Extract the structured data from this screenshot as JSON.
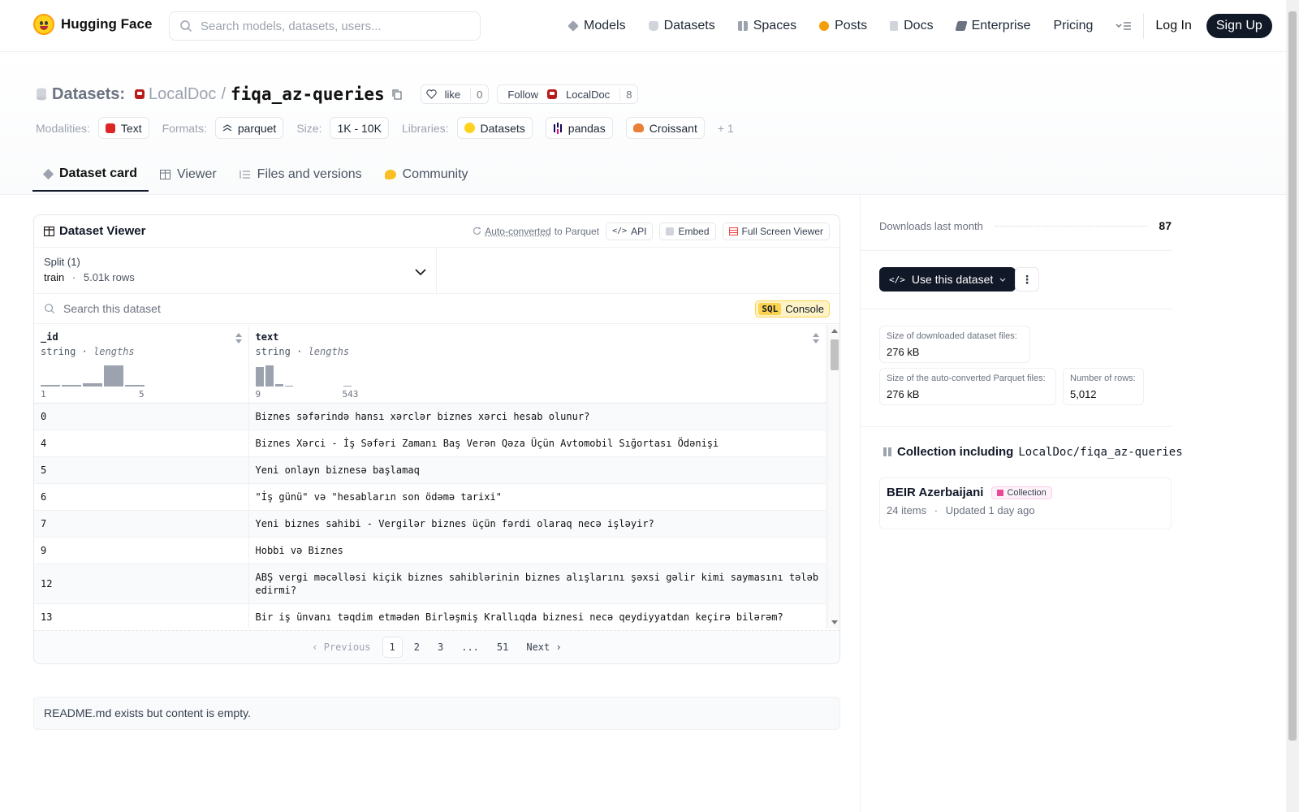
{
  "header": {
    "brand": "Hugging Face",
    "search_placeholder": "Search models, datasets, users...",
    "nav": [
      {
        "label": "Models",
        "icon": "models-icon",
        "color": "#6b7280"
      },
      {
        "label": "Datasets",
        "icon": "datasets-icon",
        "color": "#9ca3af"
      },
      {
        "label": "Spaces",
        "icon": "spaces-icon",
        "color": "#9ca3af"
      },
      {
        "label": "Posts",
        "icon": "posts-icon",
        "color": "#f59e0b"
      },
      {
        "label": "Docs",
        "icon": "docs-icon",
        "color": "#9ca3af"
      },
      {
        "label": "Enterprise",
        "icon": "enterprise-icon",
        "color": "#6b7280"
      },
      {
        "label": "Pricing",
        "icon": "",
        "color": ""
      }
    ],
    "login": "Log In",
    "signup": "Sign Up"
  },
  "repo": {
    "type_label": "Datasets:",
    "org": "LocalDoc",
    "slash": "/",
    "name": "fiqa_az-queries",
    "like_label": "like",
    "like_count": "0",
    "follow_label": "Follow",
    "follow_org": "LocalDoc",
    "follow_count": "8"
  },
  "meta": {
    "modalities_label": "Modalities:",
    "modality": "Text",
    "formats_label": "Formats:",
    "format": "parquet",
    "size_label": "Size:",
    "size": "1K - 10K",
    "libraries_label": "Libraries:",
    "libraries": [
      "Datasets",
      "pandas",
      "Croissant"
    ],
    "more": "+ 1"
  },
  "tabs": [
    "Dataset card",
    "Viewer",
    "Files and versions",
    "Community"
  ],
  "viewer": {
    "title": "Dataset Viewer",
    "auto_converted": "Auto-converted",
    "to_parquet": "to Parquet",
    "api": "API",
    "embed": "Embed",
    "full_screen": "Full Screen Viewer",
    "split_title": "Split (1)",
    "split_name": "train",
    "split_dot": "·",
    "split_rows": "5.01k rows",
    "search_placeholder": "Search this dataset",
    "sql": "SQL",
    "console": "Console",
    "columns": [
      {
        "name": "_id",
        "type": "string",
        "dot": "·",
        "stat": "lengths",
        "min": "1",
        "max": "5"
      },
      {
        "name": "text",
        "type": "string",
        "dot": "·",
        "stat": "lengths",
        "min": "9",
        "max": "543"
      }
    ],
    "rows": [
      {
        "id": "0",
        "text": "Biznes səfərində hansı xərclər biznes xərci hesab olunur?"
      },
      {
        "id": "4",
        "text": "Biznes Xərci - İş Səfəri Zamanı Baş Verən Qəza Üçün Avtomobil Sığortası Ödənişi"
      },
      {
        "id": "5",
        "text": "Yeni onlayn biznesə başlamaq"
      },
      {
        "id": "6",
        "text": "\"İş günü\" və \"hesabların son ödəmə tarixi\""
      },
      {
        "id": "7",
        "text": "Yeni biznes sahibi - Vergilər biznes üçün fərdi olaraq necə işləyir?"
      },
      {
        "id": "9",
        "text": "Hobbi və Biznes"
      },
      {
        "id": "12",
        "text": "ABŞ vergi məcəlləsi kiçik biznes sahiblərinin biznes alışlarını şəxsi gəlir kimi saymasını tələb edirmi?"
      },
      {
        "id": "13",
        "text": "Bir iş ünvanı təqdim etmədən Birləşmiş Krallıqda biznesi necə qeydiyyatdan keçirə bilərəm?"
      }
    ],
    "pager": {
      "prev": "Previous",
      "pages": [
        "1",
        "2",
        "3",
        "...",
        "51"
      ],
      "next": "Next"
    }
  },
  "readme": "README.md exists but content is empty.",
  "sidebar": {
    "downloads_label": "Downloads last month",
    "downloads": "87",
    "use_button": "Use this dataset",
    "stats": [
      {
        "label": "Size of downloaded dataset files:",
        "value": "276 kB"
      },
      {
        "label": "Size of the auto-converted Parquet files:",
        "value": "276 kB"
      },
      {
        "label": "Number of rows:",
        "value": "5,012"
      }
    ],
    "collection_title": "Collection including",
    "collection_repo": "LocalDoc/fiqa_az-queries",
    "collection": {
      "name": "BEIR Azerbaijani",
      "badge": "Collection",
      "items": "24 items",
      "dot": "·",
      "updated": "Updated 1 day ago"
    }
  }
}
